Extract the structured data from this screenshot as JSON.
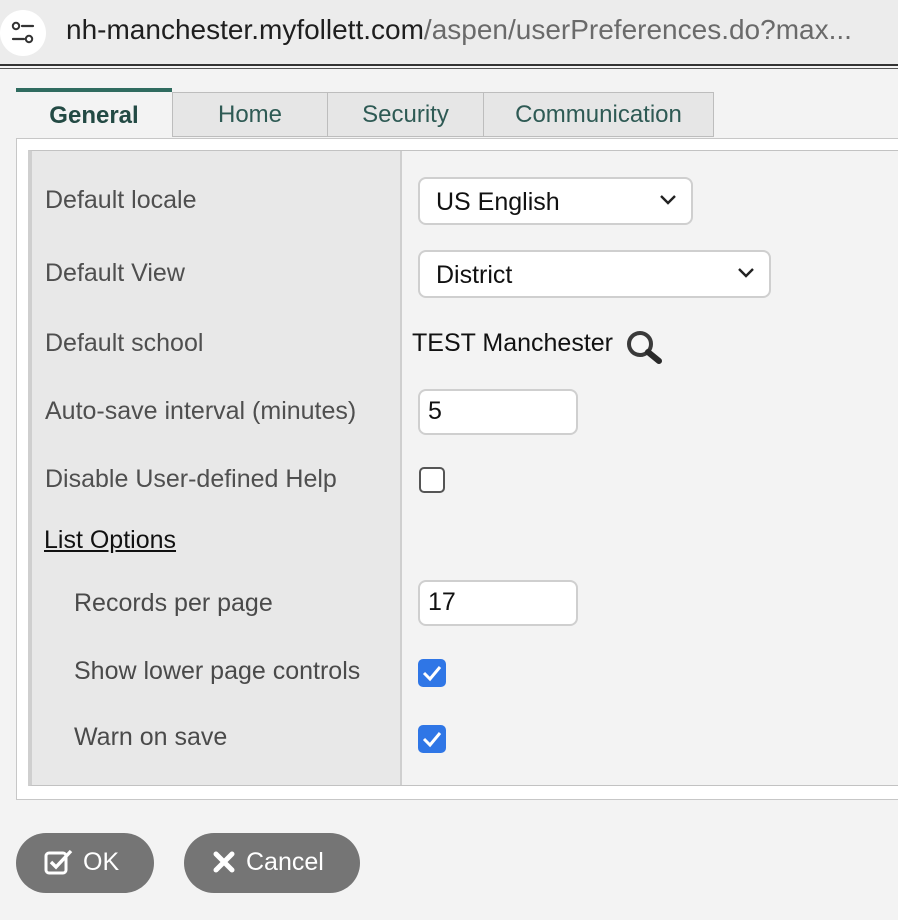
{
  "browser": {
    "url_host": "nh-manchester.myfollett.com",
    "url_path": "/aspen/userPreferences.do?max..."
  },
  "tabs": [
    {
      "label": "General",
      "active": true
    },
    {
      "label": "Home",
      "active": false
    },
    {
      "label": "Security",
      "active": false
    },
    {
      "label": "Communication",
      "active": false
    }
  ],
  "form": {
    "default_locale": {
      "label": "Default locale",
      "value": "US English"
    },
    "default_view": {
      "label": "Default View",
      "value": "District"
    },
    "default_school": {
      "label": "Default school",
      "value": "TEST Manchester"
    },
    "autosave": {
      "label": "Auto-save interval (minutes)",
      "value": "5"
    },
    "disable_help": {
      "label": "Disable User-defined Help",
      "checked": false
    },
    "list_options": {
      "label": "List Options"
    },
    "records_per_page": {
      "label": "Records per page",
      "value": "17"
    },
    "show_lower_controls": {
      "label": "Show lower page controls",
      "checked": true
    },
    "warn_on_save": {
      "label": "Warn on save",
      "checked": true
    }
  },
  "buttons": {
    "ok": "OK",
    "cancel": "Cancel"
  },
  "colors": {
    "accent": "#2f6b5f",
    "checkbox": "#2f76e6",
    "button": "#757575"
  }
}
